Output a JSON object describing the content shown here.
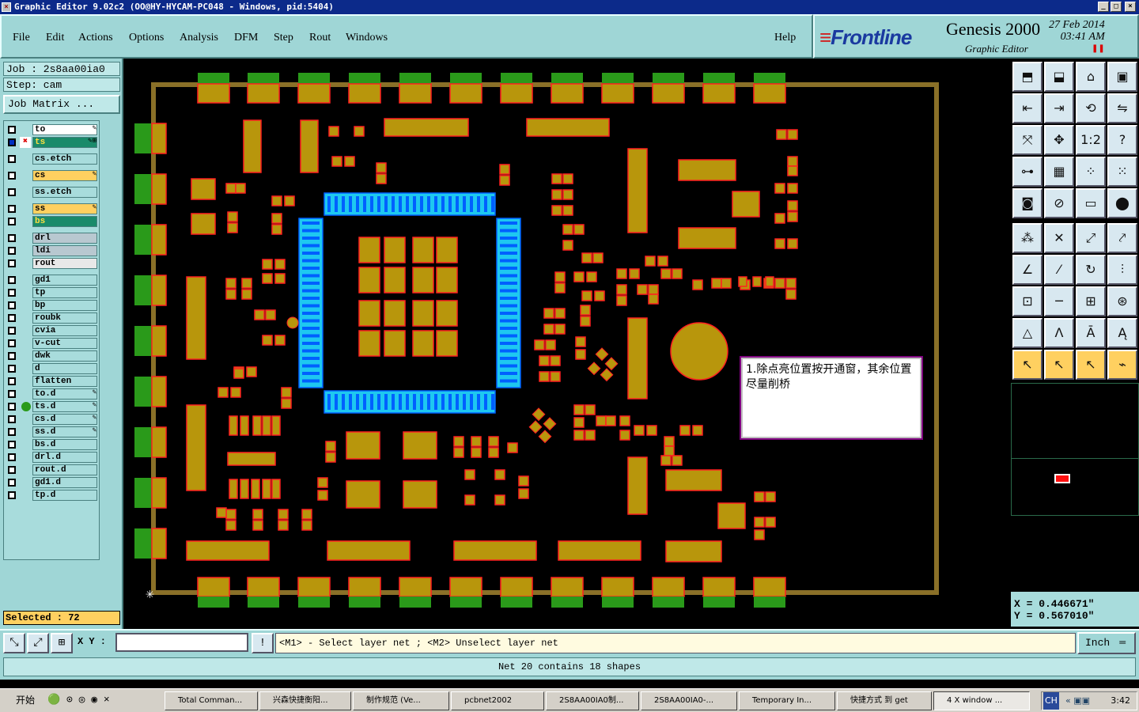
{
  "window": {
    "title": "Graphic Editor 9.02c2 (OO@HY-HYCAM-PC048 - Windows, pid:5404)",
    "controls": [
      "_",
      "□",
      "×"
    ]
  },
  "menu": {
    "items": [
      "File",
      "Edit",
      "Actions",
      "Options",
      "Analysis",
      "DFM",
      "Step",
      "Rout",
      "Windows"
    ],
    "help": "Help"
  },
  "brand": {
    "logo": "Frontline",
    "product": "Genesis 2000",
    "subtitle": "Graphic Editor",
    "date": "27 Feb 2014",
    "time": "03:41 AM"
  },
  "job": {
    "job_label": "Job : 2s8aa00ia0",
    "step_label": "Step: cam",
    "matrix_button": "Job Matrix ..."
  },
  "layers": [
    {
      "name": "to",
      "color": "#ffffff",
      "flag": "✎"
    },
    {
      "name": "ts",
      "color": "#1a8a6a",
      "flag": "✎⊞",
      "active": true
    },
    {
      "name": "cs.etch",
      "color": "#a8dcdc"
    },
    {
      "name": "cs",
      "color": "#ffd060",
      "flag": "✎"
    },
    {
      "name": "ss.etch",
      "color": "#a8dcdc"
    },
    {
      "name": "ss",
      "color": "#ffd060",
      "flag": "✎"
    },
    {
      "name": "bs",
      "color": "#1a8a6a"
    },
    {
      "name": "drl",
      "color": "#b8c8d0"
    },
    {
      "name": "ldi",
      "color": "#b8c8d0"
    },
    {
      "name": "rout",
      "color": "#e8e8e8"
    },
    {
      "name": "gd1",
      "color": "#a8dcdc"
    },
    {
      "name": "tp",
      "color": "#a8dcdc"
    },
    {
      "name": "bp",
      "color": "#a8dcdc"
    },
    {
      "name": "roubk",
      "color": "#a8dcdc"
    },
    {
      "name": "cvia",
      "color": "#a8dcdc"
    },
    {
      "name": "v-cut",
      "color": "#a8dcdc"
    },
    {
      "name": "dwk",
      "color": "#a8dcdc"
    },
    {
      "name": "d",
      "color": "#a8dcdc"
    },
    {
      "name": "flatten",
      "color": "#a8dcdc"
    },
    {
      "name": "to.d",
      "color": "#a8dcdc",
      "flag": "✎"
    },
    {
      "name": "ts.d",
      "color": "#a8dcdc",
      "flag": "✎"
    },
    {
      "name": "cs.d",
      "color": "#a8dcdc",
      "flag": "✎"
    },
    {
      "name": "ss.d",
      "color": "#a8dcdc",
      "flag": "✎"
    },
    {
      "name": "bs.d",
      "color": "#a8dcdc"
    },
    {
      "name": "drl.d",
      "color": "#a8dcdc"
    },
    {
      "name": "rout.d",
      "color": "#a8dcdc"
    },
    {
      "name": "gd1.d",
      "color": "#a8dcdc"
    },
    {
      "name": "tp.d",
      "color": "#a8dcdc"
    }
  ],
  "selected": "Selected : 72",
  "note": "1.除点亮位置按开通窗，其余位置尽量削桥",
  "coords": {
    "x": "X = 0.446671\"",
    "y": "Y = 0.567010\""
  },
  "command": {
    "xy_label": "X Y :",
    "xy_value": "",
    "prompt": "<M1> - Select layer net ; <M2> Unselect layer net",
    "units": "Inch"
  },
  "status": "Net 20 contains 18 shapes",
  "colors": {
    "pad": "#b8960c",
    "pad_outline": "#ff2020",
    "highlight": "#1ec8f0",
    "gold_border": "#8a7028",
    "green_finger": "#2a9a1a"
  },
  "taskbar": {
    "start": "开始",
    "tasks": [
      "Total Comman...",
      "兴森快捷衡阳...",
      "制作规范 (Ve...",
      "pcbnet2002",
      "2S8AA00IA0制...",
      "2S8AA00IA0-...",
      "Temporary In...",
      "快捷方式 到 get",
      "4 X window ..."
    ],
    "clock": "3:42",
    "ime": "CH"
  }
}
